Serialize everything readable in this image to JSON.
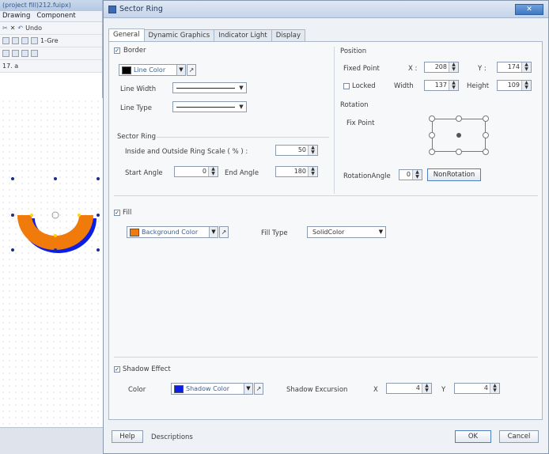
{
  "background_window": {
    "title": "(project fill)212.fuipx)",
    "menu": [
      "Drawing",
      "Component"
    ],
    "undo_label": "Undo",
    "toolbar_text": "1-Gre",
    "toolbar_row3": "17. a"
  },
  "dialog": {
    "title": "Sector Ring",
    "close_label": "✕",
    "tabs": [
      "General",
      "Dynamic Graphics",
      "Indicator Light",
      "Display"
    ],
    "border": {
      "label": "Border",
      "checked": true,
      "line_color": {
        "label": "Line Color",
        "color": "#000000"
      },
      "line_width_label": "Line Width",
      "line_type_label": "Line Type"
    },
    "position": {
      "label": "Position",
      "fixed_point_label": "Fixed Point",
      "x_label": "X :",
      "x_value": "208",
      "y_label": "Y :",
      "y_value": "174",
      "locked_label": "Locked",
      "locked_checked": false,
      "width_label": "Width",
      "width_value": "137",
      "height_label": "Height",
      "height_value": "109"
    },
    "rotation": {
      "label": "Rotation",
      "fix_point_label": "Fix Point",
      "angle_label": "RotationAngle",
      "angle_value": "0",
      "no_rotation_label": "NonRotation"
    },
    "sector_ring": {
      "label": "Sector Ring",
      "ring_scale_label": "Inside and Outside Ring Scale ( % ) :",
      "ring_scale_value": "50",
      "start_angle_label": "Start Angle",
      "start_angle_value": "0",
      "end_angle_label": "End Angle",
      "end_angle_value": "180"
    },
    "fill": {
      "label": "Fill",
      "checked": true,
      "background_color": {
        "label": "Background Color",
        "color": "#f07a0a"
      },
      "fill_type_label": "Fill Type",
      "fill_type_value": "SolidColor"
    },
    "shadow": {
      "label": "Shadow Effect",
      "checked": true,
      "color_label": "Color",
      "shadow_color": {
        "label": "Shadow Color",
        "color": "#0a1ee6"
      },
      "excursion_label": "Shadow Excursion",
      "x_label": "X",
      "x_value": "4",
      "y_label": "Y",
      "y_value": "4"
    },
    "buttons": {
      "help": "Help",
      "description": "Descriptions",
      "ok": "OK",
      "cancel": "Cancel"
    }
  }
}
